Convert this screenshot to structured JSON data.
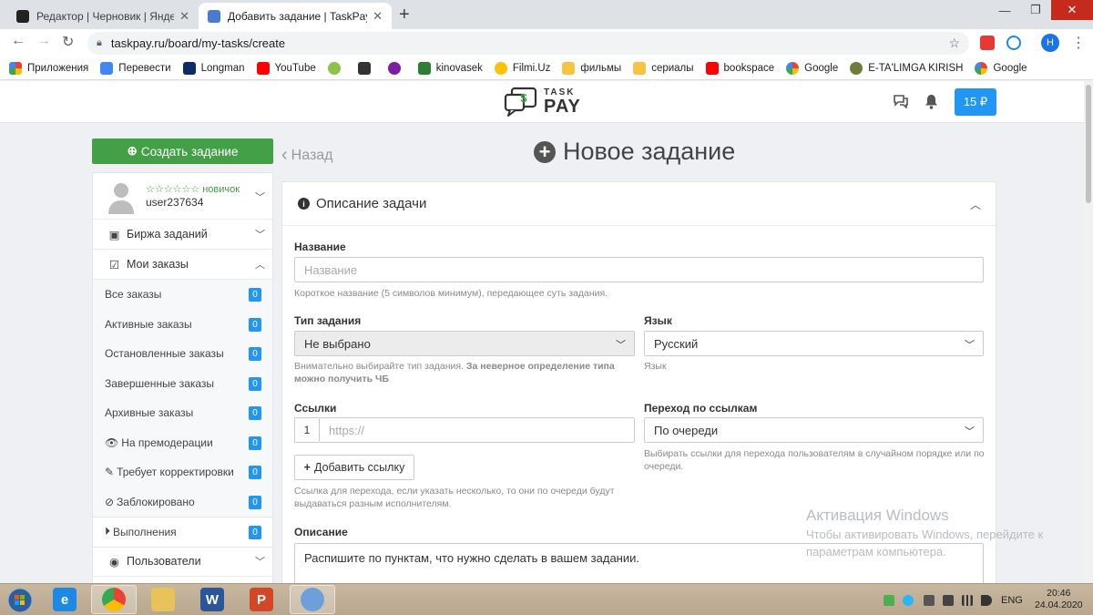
{
  "browser": {
    "tabs": [
      {
        "title": "Редактор | Черновик | Яндекс Д",
        "active": false
      },
      {
        "title": "Добавить задание | TaskPay",
        "active": true
      }
    ],
    "url": "taskpay.ru/board/my-tasks/create",
    "profile_initial": "H",
    "bookmarks": [
      "Приложения",
      "Перевести",
      "Longman",
      "YouTube",
      "",
      "",
      "",
      "kinovasek",
      "Filmi.Uz",
      "фильмы",
      "сериалы",
      "bookspace",
      "Google",
      "E-TA'LIMGA KIRISH",
      "Google"
    ]
  },
  "header": {
    "logo_top": "TASK",
    "logo_bottom": "PAY",
    "balance": "15 ₽"
  },
  "sidebar": {
    "create_button": "Создать задание",
    "user": {
      "rank": "☆☆☆☆☆☆ новичок",
      "name": "user237634"
    },
    "exchange": "Биржа заданий",
    "my_orders": "Мои заказы",
    "items": [
      {
        "label": "Все заказы",
        "count": "0"
      },
      {
        "label": "Активные заказы",
        "count": "0"
      },
      {
        "label": "Остановленные заказы",
        "count": "0"
      },
      {
        "label": "Завершенные заказы",
        "count": "0"
      },
      {
        "label": "Архивные заказы",
        "count": "0"
      },
      {
        "label": "На премодерации",
        "count": "0"
      },
      {
        "label": "Требует корректировки",
        "count": "0"
      },
      {
        "label": "Заблокировано",
        "count": "0"
      }
    ],
    "executions": {
      "label": "Выполнения",
      "count": "0"
    },
    "users": "Пользователи"
  },
  "main": {
    "back": "Назад",
    "title": "Новое задание",
    "panel_title": "Описание задачи",
    "name": {
      "label": "Название",
      "placeholder": "Название",
      "help": "Короткое название (5 символов минимум), передающее суть задания."
    },
    "task_type": {
      "label": "Тип задания",
      "value": "Не выбрано",
      "help_plain": "Внимательно выбирайте тип задания.",
      "help_bold": "За неверное определение типа можно получить ЧБ"
    },
    "language": {
      "label": "Язык",
      "value": "Русский",
      "help": "Язык"
    },
    "links": {
      "label": "Ссылки",
      "index": "1",
      "placeholder": "https://",
      "add_button": "Добавить ссылку",
      "help": "Ссылка для перехода, если указать несколько, то они по очереди будут выдаваться разным исполнителям."
    },
    "link_mode": {
      "label": "Переход по ссылкам",
      "value": "По очереди",
      "help": "Выбирать ссылки для перехода пользователям в случайном порядке или по очереди."
    },
    "description": {
      "label": "Описание",
      "value": "Распишите по пунктам, что нужно сделать в вашем задании."
    }
  },
  "watermark": {
    "title": "Активация Windows",
    "line1": "Чтобы активировать Windows, перейдите к",
    "line2": "параметрам компьютера."
  },
  "taskbar": {
    "lang": "ENG",
    "time": "20:46",
    "date": "24.04.2020"
  }
}
